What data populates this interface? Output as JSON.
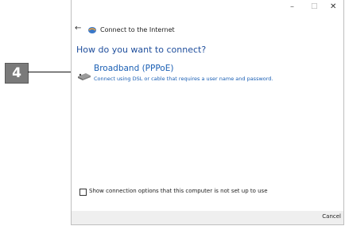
{
  "callout": {
    "step_number": "4"
  },
  "window": {
    "controls": {
      "minimize": "–",
      "maximize": "□",
      "close": "✕"
    },
    "nav": {
      "back_icon": "←",
      "title": "Connect to the Internet"
    },
    "question": "How do you want to connect?",
    "option": {
      "title": "Broadband (PPPoE)",
      "description": "Connect using DSL or cable that requires a user name and password."
    },
    "checkbox_label": "Show connection options that this computer is not set up to use",
    "footer": {
      "cancel": "Cancel"
    }
  }
}
